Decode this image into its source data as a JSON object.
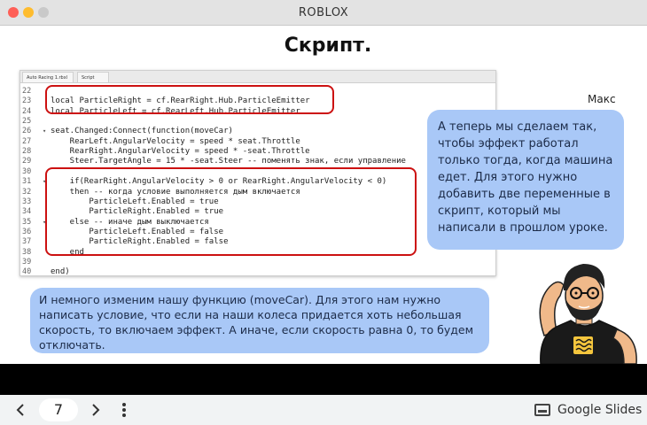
{
  "window": {
    "title": "ROBLOX"
  },
  "slide": {
    "title": "Скрипт.",
    "editor": {
      "tabs": [
        "Auto Racing 1.rbxl",
        "Script"
      ],
      "lines": [
        {
          "n": "22",
          "fold": "",
          "text": ""
        },
        {
          "n": "23",
          "fold": "",
          "text": "local ParticleRight = cf.RearRight.Hub.ParticleEmitter"
        },
        {
          "n": "24",
          "fold": "",
          "text": "local ParticleLeft = cf.RearLeft.Hub.ParticleEmitter"
        },
        {
          "n": "25",
          "fold": "",
          "text": ""
        },
        {
          "n": "26",
          "fold": "▾",
          "text": "seat.Changed:Connect(function(moveCar)"
        },
        {
          "n": "27",
          "fold": "",
          "text": "    RearLeft.AngularVelocity = speed * seat.Throttle"
        },
        {
          "n": "28",
          "fold": "",
          "text": "    RearRight.AngularVelocity = speed * -seat.Throttle"
        },
        {
          "n": "29",
          "fold": "",
          "text": "    Steer.TargetAngle = 15 * -seat.Steer -- поменять знак, если управление"
        },
        {
          "n": "30",
          "fold": "",
          "text": ""
        },
        {
          "n": "31",
          "fold": "▾",
          "text": "    if(RearRight.AngularVelocity > 0 or RearRight.AngularVelocity < 0)"
        },
        {
          "n": "32",
          "fold": "",
          "text": "    then -- когда условие выполняется дым включается"
        },
        {
          "n": "33",
          "fold": "",
          "text": "        ParticleLeft.Enabled = true"
        },
        {
          "n": "34",
          "fold": "",
          "text": "        ParticleRight.Enabled = true"
        },
        {
          "n": "35",
          "fold": "▾",
          "text": "    else -- иначе дым выключается"
        },
        {
          "n": "36",
          "fold": "",
          "text": "        ParticleLeft.Enabled = false"
        },
        {
          "n": "37",
          "fold": "",
          "text": "        ParticleRight.Enabled = false"
        },
        {
          "n": "38",
          "fold": "",
          "text": "    end"
        },
        {
          "n": "39",
          "fold": "",
          "text": ""
        },
        {
          "n": "40",
          "fold": "",
          "text": "end)"
        }
      ]
    },
    "speaker": "Макс",
    "bubble_right": "А теперь мы сделаем так, чтобы эффект работал только тогда, когда машина едет. Для этого нужно добавить две переменные в скрипт, который мы написали в прошлом уроке.",
    "bubble_bottom": "И немного изменим нашу функцию (moveCar). Для этого нам нужно написать условие, что если на наши колеса придается хоть небольшая скорость, то включаем эффект. А иначе, если скорость равна 0, то будем отключать.",
    "highlight_color": "#cc1111",
    "bubble_color": "#a9c8f7"
  },
  "footer": {
    "prev_icon": "chevron-left-icon",
    "next_icon": "chevron-right-icon",
    "page_number": "7",
    "more_icon": "kebab-icon",
    "app_name": "Google Slides"
  }
}
